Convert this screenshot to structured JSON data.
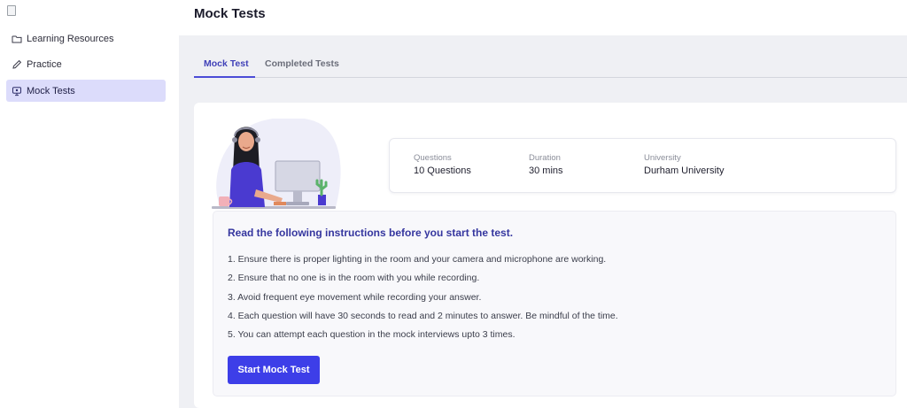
{
  "header": {
    "title": "Mock Tests"
  },
  "sidebar": {
    "items": [
      {
        "label": "Learning Resources",
        "icon": "folder-icon"
      },
      {
        "label": "Practice",
        "icon": "pencil-icon"
      },
      {
        "label": "Mock Tests",
        "icon": "monitor-icon",
        "active": true
      }
    ]
  },
  "tabs": [
    {
      "label": "Mock Test",
      "active": true
    },
    {
      "label": "Completed Tests",
      "active": false
    }
  ],
  "test_info": {
    "questions": {
      "label": "Questions",
      "value": "10 Questions"
    },
    "duration": {
      "label": "Duration",
      "value": "30 mins"
    },
    "university": {
      "label": "University",
      "value": "Durham University"
    }
  },
  "instructions": {
    "heading": "Read the following instructions before you start the test.",
    "items": [
      "1. Ensure there is proper lighting in the room and your camera and microphone are working.",
      "2. Ensure that no one is in the room with you while recording.",
      "3. Avoid frequent eye movement while recording your answer.",
      "4. Each question will have 30 seconds to read and 2 minutes to answer. Be mindful of the time.",
      "5. You can attempt each question in the mock interviews upto 3 times."
    ]
  },
  "start_button": {
    "label": "Start Mock Test"
  },
  "colors": {
    "accent": "#3d3ee8",
    "active_nav_bg": "#dcdcfb",
    "heading": "#35369f",
    "page_bg": "#eff0f4"
  }
}
